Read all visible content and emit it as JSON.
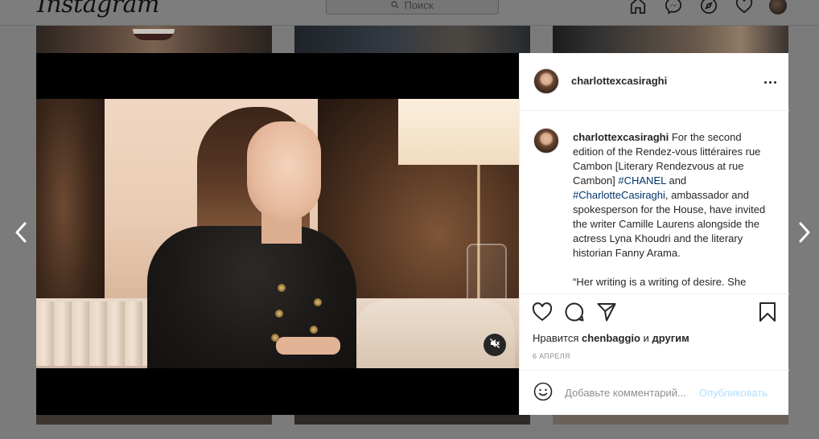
{
  "nav": {
    "logo": "Instagram",
    "search_placeholder": "Поиск"
  },
  "post": {
    "username": "charlottexcasiraghi",
    "caption": {
      "username": "charlottexcasiraghi",
      "text_1": " For the second edition of the Rendez-vous littéraires rue Cambon [Literary Rendezvous at rue Cambon] ",
      "tag_1": "#CHANEL",
      "text_2": " and ",
      "tag_2": "#CharlotteCasiraghi",
      "text_3": ", ambassador and spokesperson for the House, have invited the writer Camille Laurens alongside the actress Lyna Khoudri and the literary historian Fanny Arama.",
      "quote": "“Her writing is a writing of desire. She"
    },
    "likes": {
      "prefix": "Нравится ",
      "user": "chenbaggio",
      "middle": " и ",
      "others": "другим"
    },
    "date": "6 АПРЕЛЯ",
    "comment": {
      "placeholder": "Добавьте комментарий...",
      "post_label": "Опубликовать"
    }
  },
  "colors": {
    "hashtag": "#00376b",
    "post_button_disabled": "#b2dffc",
    "secondary_text": "#8e8e8e"
  },
  "icons": [
    "home-icon",
    "messenger-icon",
    "explore-icon",
    "activity-heart-icon",
    "more-icon",
    "like-heart-icon",
    "comment-icon",
    "share-icon",
    "save-bookmark-icon",
    "emoji-icon",
    "mute-icon",
    "chevron-left-icon",
    "chevron-right-icon"
  ]
}
